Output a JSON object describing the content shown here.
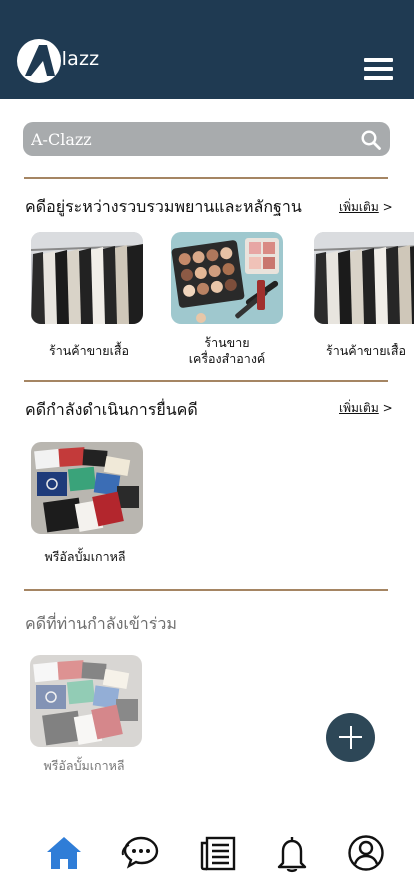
{
  "header": {
    "logo_text": "clazz",
    "brand_color": "#1f3a52"
  },
  "search": {
    "placeholder": "A-Clazz",
    "icon": "search-icon"
  },
  "sections": {
    "evidence": {
      "title": "คดีอยู่ระหว่างรวบรวมพยานและหลักฐาน",
      "more_label": "เพิ่มเติม",
      "more_arrow": ">",
      "cards": [
        {
          "line1": "ร้านค้าขายเสื้อ",
          "line2": ""
        },
        {
          "line1": "ร้านขาย",
          "line2": "เครื่องสำอางค์"
        },
        {
          "line1": "ร้านค้าขายเสื้อ",
          "line2": ""
        }
      ]
    },
    "filing": {
      "title": "คดีกำลังดำเนินการยื่นคดี",
      "more_label": "เพิ่มเติม",
      "more_arrow": ">",
      "cards": [
        {
          "line1": "พรีอัลบั้มเกาหลี"
        }
      ]
    },
    "joined": {
      "title": "คดีที่ท่านกำลังเข้าร่วม",
      "cards": [
        {
          "line1": "พรีอัลบั้มเกาหลี"
        }
      ]
    }
  },
  "fab": {
    "icon": "plus-icon"
  },
  "bottom_nav": {
    "items": [
      "home-icon",
      "chat-icon",
      "news-icon",
      "bell-icon",
      "profile-icon"
    ],
    "active": "home-icon",
    "active_color": "#2f7dd7"
  },
  "colors": {
    "accent_divider": "#a58563",
    "search_bg": "#a8abad",
    "fab_bg": "#2d4757"
  }
}
